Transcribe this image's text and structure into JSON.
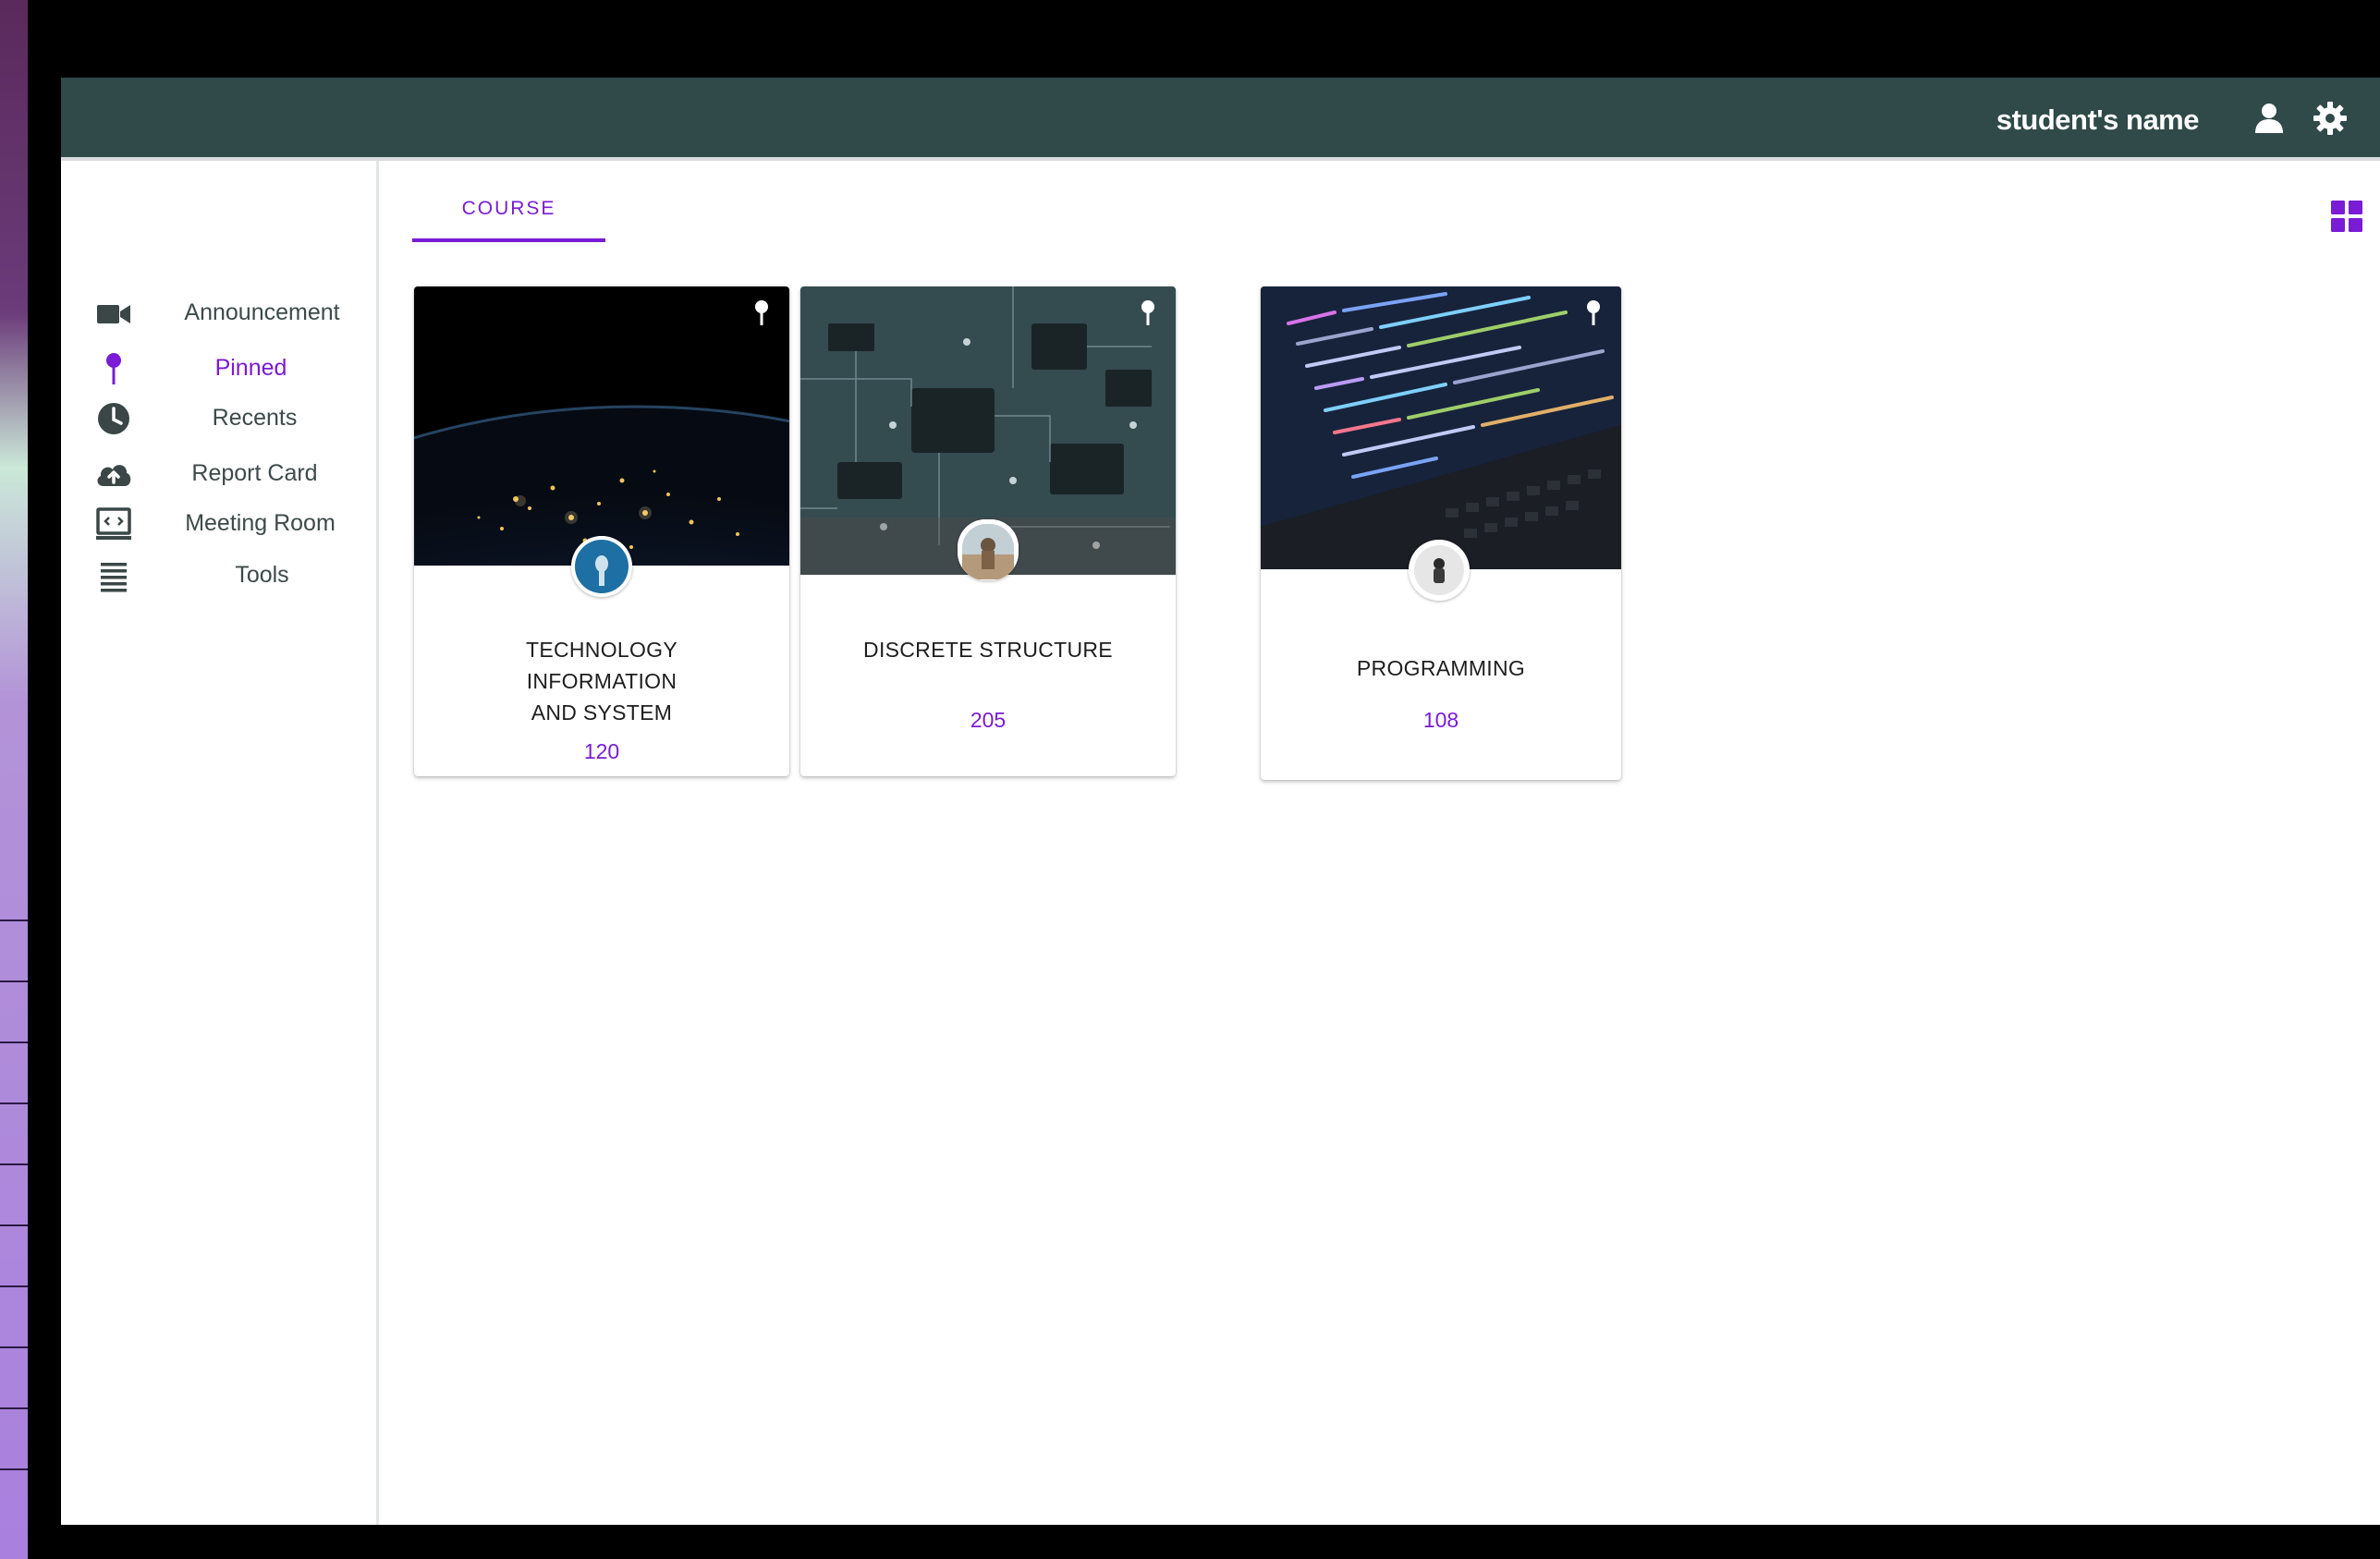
{
  "header": {
    "user_name": "student's name",
    "profile_icon": "user-icon",
    "settings_icon": "gear-icon"
  },
  "sidebar": {
    "items": [
      {
        "label": "Announcement",
        "icon": "video-camera-icon",
        "active": false
      },
      {
        "label": "Pinned",
        "icon": "pin-icon",
        "active": true
      },
      {
        "label": "Recents",
        "icon": "clock-icon",
        "active": false
      },
      {
        "label": "Report Card",
        "icon": "cloud-upload-icon",
        "active": false
      },
      {
        "label": "Meeting Room",
        "icon": "monitor-code-icon",
        "active": false
      },
      {
        "label": "Tools",
        "icon": "list-icon",
        "active": false
      }
    ]
  },
  "main": {
    "tab_label": "COURSE",
    "view_toggle_icon": "grid-view-icon",
    "courses": [
      {
        "title_lines": [
          "TECHNOLOGY",
          "INFORMATION",
          "AND SYSTEM"
        ],
        "count": "120",
        "pinned": true
      },
      {
        "title_lines": [
          "DISCRETE STRUCTURE"
        ],
        "count": "205",
        "pinned": true
      },
      {
        "title_lines": [
          "PROGRAMMING"
        ],
        "count": "108",
        "pinned": true
      }
    ]
  },
  "colors": {
    "header_bg": "#2f4a48",
    "accent": "#7a1bd6",
    "sidebar_text": "#3d4a4a",
    "icon_dark": "#3b4747"
  }
}
